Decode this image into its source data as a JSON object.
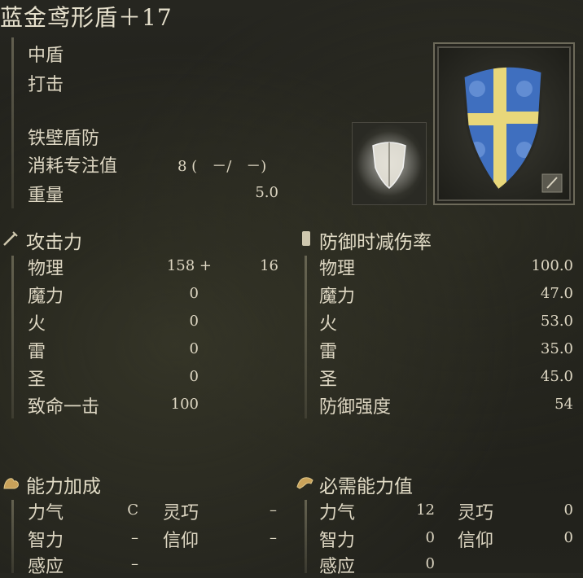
{
  "title": "蓝金鸢形盾＋17",
  "info": {
    "type": "中盾",
    "damage_type": "打击",
    "skill": "铁壁盾防",
    "fp_label": "消耗专注值",
    "fp_value": "8 (　－/　－)",
    "weight_label": "重量",
    "weight_value": "5.0"
  },
  "attack": {
    "header": "攻击力",
    "rows": [
      {
        "label": "物理",
        "value": "158 +",
        "extra": "16"
      },
      {
        "label": "魔力",
        "value": "0",
        "extra": ""
      },
      {
        "label": "火",
        "value": "0",
        "extra": ""
      },
      {
        "label": "雷",
        "value": "0",
        "extra": ""
      },
      {
        "label": "圣",
        "value": "0",
        "extra": ""
      },
      {
        "label": "致命一击",
        "value": "100",
        "extra": ""
      }
    ]
  },
  "guard": {
    "header": "防御时减伤率",
    "rows": [
      {
        "label": "物理",
        "value": "100.0"
      },
      {
        "label": "魔力",
        "value": "47.0"
      },
      {
        "label": "火",
        "value": "53.0"
      },
      {
        "label": "雷",
        "value": "35.0"
      },
      {
        "label": "圣",
        "value": "45.0"
      },
      {
        "label": "防御强度",
        "value": "54"
      }
    ]
  },
  "scaling": {
    "header": "能力加成",
    "rows": [
      {
        "l1": "力气",
        "v1": "C",
        "l2": "灵巧",
        "v2": "–"
      },
      {
        "l1": "智力",
        "v1": "–",
        "l2": "信仰",
        "v2": "–"
      },
      {
        "l1": "感应",
        "v1": "–",
        "l2": "",
        "v2": ""
      }
    ]
  },
  "requirements": {
    "header": "必需能力值",
    "rows": [
      {
        "l1": "力气",
        "v1": "12",
        "l2": "灵巧",
        "v2": "0"
      },
      {
        "l1": "智力",
        "v1": "0",
        "l2": "信仰",
        "v2": "0"
      },
      {
        "l1": "感应",
        "v1": "0",
        "l2": "",
        "v2": ""
      }
    ]
  },
  "icons": {
    "attack": "sword-icon",
    "guard": "shield-icon",
    "scaling": "arm-icon",
    "requirements": "hand-icon",
    "shield_image": "blue-gold-kite-shield-icon",
    "skill_image": "barricade-shield-skill-icon"
  },
  "colors": {
    "shield_blue": "#3f6fbf",
    "shield_gold": "#e8d77a",
    "text": "#ddd6c2"
  }
}
